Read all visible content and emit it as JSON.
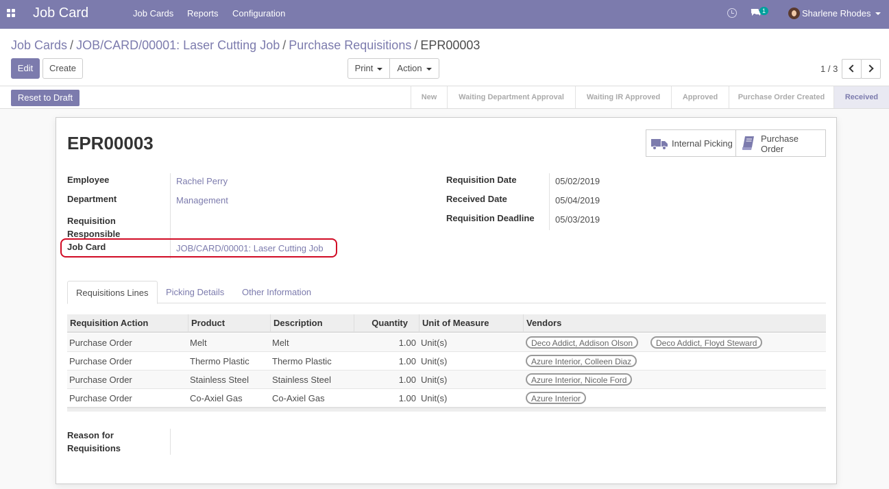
{
  "navbar": {
    "brand": "Job Card",
    "menu": [
      "Job Cards",
      "Reports",
      "Configuration"
    ],
    "chat_badge": "1",
    "user": "Sharlene Rhodes"
  },
  "breadcrumb": {
    "items": [
      "Job Cards",
      "JOB/CARD/00001: Laser Cutting Job",
      "Purchase Requisitions"
    ],
    "current": "EPR00003",
    "separator": "/"
  },
  "toolbar": {
    "edit": "Edit",
    "create": "Create",
    "print": "Print",
    "action": "Action",
    "pager": "1 / 3"
  },
  "statusbar": {
    "reset": "Reset to Draft",
    "stages": [
      "New",
      "Waiting Department Approval",
      "Waiting IR Approved",
      "Approved",
      "Purchase Order Created",
      "Received"
    ],
    "active_stage": "Received"
  },
  "record": {
    "title": "EPR00003",
    "smart_buttons": {
      "internal_picking": "Internal Picking",
      "purchase_order": "Purchase Order"
    },
    "left_fields": [
      {
        "label": "Employee",
        "value": "Rachel Perry"
      },
      {
        "label": "Department",
        "value": "Management"
      },
      {
        "label": "Requisition Responsible",
        "value": ""
      },
      {
        "label": "Job Card",
        "value": "JOB/CARD/00001: Laser Cutting Job"
      }
    ],
    "right_fields": [
      {
        "label": "Requisition Date",
        "value": "05/02/2019"
      },
      {
        "label": "Received Date",
        "value": "05/04/2019"
      },
      {
        "label": "Requisition Deadline",
        "value": "05/03/2019"
      }
    ],
    "reason_label": "Reason for Requisitions"
  },
  "tabs": [
    "Requisitions Lines",
    "Picking Details",
    "Other Information"
  ],
  "lines": {
    "columns": [
      "Requisition Action",
      "Product",
      "Description",
      "Quantity",
      "Unit of Measure",
      "Vendors"
    ],
    "rows": [
      {
        "action": "Purchase Order",
        "product": "Melt",
        "description": "Melt",
        "quantity": "1.00",
        "uom": "Unit(s)",
        "vendors": [
          "Deco Addict, Addison Olson",
          "Deco Addict, Floyd Steward"
        ]
      },
      {
        "action": "Purchase Order",
        "product": "Thermo Plastic",
        "description": "Thermo Plastic",
        "quantity": "1.00",
        "uom": "Unit(s)",
        "vendors": [
          "Azure Interior, Colleen Diaz"
        ]
      },
      {
        "action": "Purchase Order",
        "product": "Stainless Steel",
        "description": "Stainless Steel",
        "quantity": "1.00",
        "uom": "Unit(s)",
        "vendors": [
          "Azure Interior, Nicole Ford"
        ]
      },
      {
        "action": "Purchase Order",
        "product": "Co-Axiel Gas",
        "description": "Co-Axiel Gas",
        "quantity": "1.00",
        "uom": "Unit(s)",
        "vendors": [
          "Azure Interior"
        ]
      }
    ]
  },
  "colors": {
    "brand": "#7c7bad",
    "highlight": "#d10a24",
    "badge": "#00a09d"
  },
  "icons": [
    "apps-grid-icon",
    "clock-icon",
    "chat-icon",
    "truck-icon",
    "book-icon",
    "chevron-left-icon",
    "chevron-right-icon"
  ]
}
